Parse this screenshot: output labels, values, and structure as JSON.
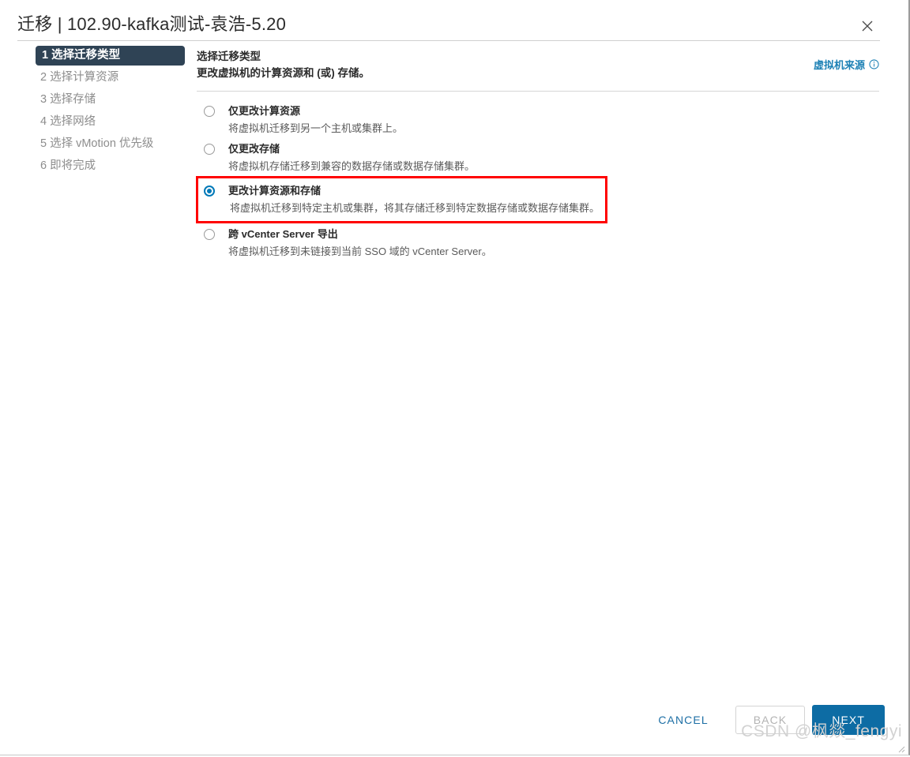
{
  "window": {
    "title": "迁移 | 102.90-kafka测试-袁浩-5.20",
    "close_icon": "close-icon"
  },
  "sidebar": {
    "steps": [
      {
        "num": "1",
        "label": "选择迁移类型",
        "active": true
      },
      {
        "num": "2",
        "label": "选择计算资源",
        "active": false
      },
      {
        "num": "3",
        "label": "选择存储",
        "active": false
      },
      {
        "num": "4",
        "label": "选择网络",
        "active": false
      },
      {
        "num": "5",
        "label": "选择 vMotion 优先级",
        "active": false
      },
      {
        "num": "6",
        "label": "即将完成",
        "active": false
      }
    ]
  },
  "main": {
    "title": "选择迁移类型",
    "subtitle": "更改虚拟机的计算资源和 (或) 存储。",
    "vm_source_link": "虚拟机来源",
    "vm_source_icon": "info-circle-icon",
    "options": [
      {
        "label": "仅更改计算资源",
        "desc": "将虚拟机迁移到另一个主机或集群上。",
        "selected": false,
        "highlighted": false
      },
      {
        "label": "仅更改存储",
        "desc": "将虚拟机存储迁移到兼容的数据存储或数据存储集群。",
        "selected": false,
        "highlighted": false
      },
      {
        "label": "更改计算资源和存储",
        "desc": "将虚拟机迁移到特定主机或集群，将其存储迁移到特定数据存储或数据存储集群。",
        "selected": true,
        "highlighted": true
      },
      {
        "label": "跨 vCenter Server 导出",
        "desc": "将虚拟机迁移到未链接到当前 SSO 域的 vCenter Server。",
        "selected": false,
        "highlighted": false
      }
    ]
  },
  "footer": {
    "cancel_label": "CANCEL",
    "back_label": "BACK",
    "next_label": "NEXT"
  },
  "watermark": {
    "text": "CSDN @枫燚_fengyi"
  },
  "colors": {
    "accent_blue": "#0079b8",
    "button_blue": "#0d6ca4",
    "link_blue": "#1d81b5",
    "active_step_bg": "#2f4355",
    "highlight_red": "#ff0000"
  }
}
